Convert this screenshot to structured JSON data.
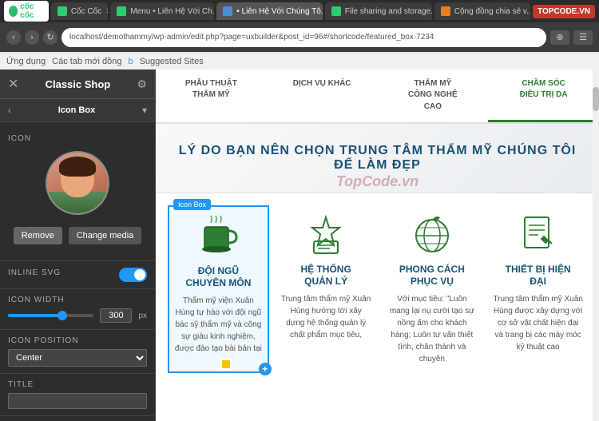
{
  "browser": {
    "tabs": [
      {
        "label": "Cốc Cốc",
        "active": false,
        "type": "coccoc"
      },
      {
        "label": "Menu • Liên Hệ Với Ch...",
        "active": false,
        "type": "green"
      },
      {
        "label": "• Liên Hệ Với Chúng Tô...",
        "active": true,
        "type": "blue"
      },
      {
        "label": "File sharing and storage...",
        "active": false,
        "type": "green"
      },
      {
        "label": "Cộng đồng chia sẻ v...",
        "active": false,
        "type": "orange"
      }
    ],
    "address": "localhost/demothammy/wp-admin/edit.php?page=uxbuilder&post_id=96#/shortcode/featured_box-7234",
    "toolbar_items": [
      "Ứng dụng",
      "Các tab mới đồng",
      "Suggested Sites"
    ]
  },
  "sidebar": {
    "title": "Classic Shop",
    "section": "Icon Box",
    "icon_label": "ICON",
    "btn_remove": "Remove",
    "btn_change": "Change media",
    "inline_svg_label": "INLINE SVG",
    "icon_width_label": "ICON WIDTH",
    "icon_width_value": "300",
    "icon_width_unit": "px",
    "icon_position_label": "ICON POSITION",
    "icon_position_value": "Center",
    "title_label": "TITLE"
  },
  "content": {
    "nav_tabs": [
      {
        "label": "PHẪU THUẬT\nTHẨM MỸ",
        "active": false
      },
      {
        "label": "DỊCH VỤ KHÁC",
        "active": false
      },
      {
        "label": "THẨM MỸ\nCÔNG NGHỆ\nCAO",
        "active": false
      },
      {
        "label": "CHĂM SÓC\nĐIỀU TRỊ DA",
        "active": true
      }
    ],
    "banner_title": "LÝ DO BẠN NÊN CHỌN TRUNG TÂM THẨM MỸ CHÚNG TÔI ĐỂ LÀM ĐẸP",
    "icon_boxes": [
      {
        "label": "Icon Box",
        "title": "ĐỘI NGŨ\nCHUYÊN MÔN",
        "desc": "Thẩm mỹ viện Xuân Hùng tự hào với đội ngũ bác sỹ thẩm mỹ và công sự giàu kinh nghiệm, được đào tạo bài bản tại",
        "highlighted": true
      },
      {
        "label": "",
        "title": "HỆ THỐNG\nQUẢN LÝ",
        "desc": "Trung tâm thẩm mỹ Xuân Hùng hướng tới xây dựng hệ thống quản lý chất phẩm mục tiêu,",
        "highlighted": false
      },
      {
        "label": "",
        "title": "PHONG CÁCH\nPHỤC VỤ",
        "desc": "Với mục tiêu: \"Luôn mang lại nụ cười tạo sự nồng ấm cho khách hàng; Luôn tư vấn thiết tình, chân thành và chuyên",
        "highlighted": false
      },
      {
        "label": "",
        "title": "THIẾT BỊ HIỆN\nĐẠI",
        "desc": "Trung tâm thẩm mỹ Xuân Hùng được xây dựng với cơ sở vật chất hiện đại và trang bị các máy móc kỹ thuật cao",
        "highlighted": false
      }
    ],
    "topcode_watermark": "TopCode.vn"
  }
}
